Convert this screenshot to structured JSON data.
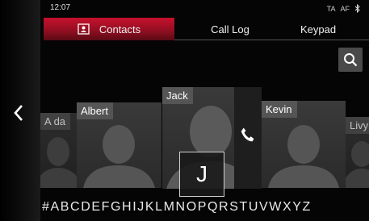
{
  "status": {
    "time": "12:07",
    "indicators": [
      "TA",
      "AF"
    ],
    "icons": [
      "bluetooth-icon"
    ]
  },
  "tabs": [
    {
      "label": "Contacts",
      "active": true,
      "icon": "contact-card-icon"
    },
    {
      "label": "Call Log",
      "active": false
    },
    {
      "label": "Keypad",
      "active": false
    }
  ],
  "contacts": [
    {
      "name": "A da"
    },
    {
      "name": "Albert"
    },
    {
      "name": "Jack"
    },
    {
      "name": "Kevin"
    },
    {
      "name": "Livy"
    }
  ],
  "current_letter": "J",
  "alphabet": "#ABCDEFGHIJKLMNOPQRSTUVWXYZ",
  "colors": {
    "accent": "#c8102e",
    "card": "#333333",
    "panel": "#1e1e1e"
  }
}
